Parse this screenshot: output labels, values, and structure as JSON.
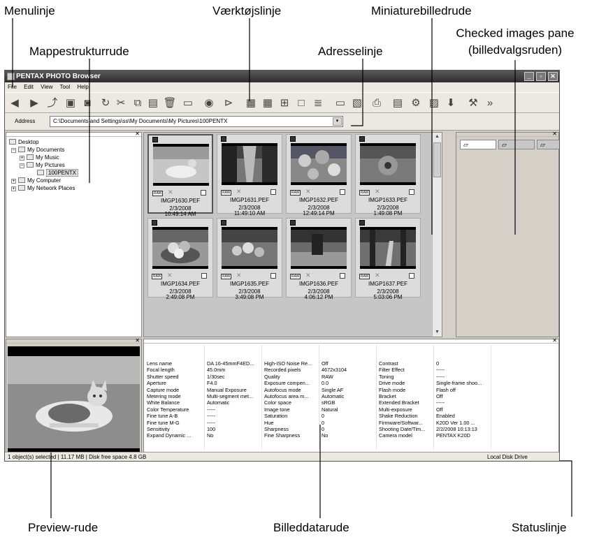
{
  "callouts": {
    "menulinje": "Menulinje",
    "vaerktojslinje": "Værktøjslinje",
    "miniaturebilledrude": "Miniaturebilledrude",
    "mappestrukturrude": "Mappestrukturrude",
    "adresselinje": "Adresselinje",
    "checked_line1": "Checked images pane",
    "checked_line2": "(billedvalgsruden)",
    "preview_rude": "Preview-rude",
    "billeddatarude": "Billeddatarude",
    "statuslinje": "Statuslinje"
  },
  "window": {
    "title": "PENTAX PHOTO Browser",
    "menu": [
      "File",
      "Edit",
      "View",
      "Tool",
      "Help"
    ],
    "address_label": "Address",
    "address_value": "C:\\Documents and Settings\\ss\\My Documents\\My Pictures\\100PENTX"
  },
  "toolbar_icons": [
    "back-icon",
    "forward-icon",
    "up-folder-icon",
    "3d-icon",
    "lab-icon",
    "rotate-icon",
    "cut-icon",
    "copy-icon",
    "paste-icon",
    "delete-icon",
    "slideshow-icon",
    "view-icon",
    "filter-icon",
    "grid-small-icon",
    "grid-large-icon",
    "grid-split-icon",
    "single-view-icon",
    "detail-view-icon",
    "panel-icon",
    "book-icon",
    "print-icon",
    "export-icon",
    "settings-icon",
    "camera-icon",
    "plugin-icon",
    "tools-icon",
    "more-icon"
  ],
  "folder_tree": {
    "desktop": "Desktop",
    "my_documents": "My Documents",
    "my_music": "My Music",
    "my_pictures": "My Pictures",
    "folder_100pentx": "100PENTX",
    "my_computer": "My Computer",
    "my_network": "My Network Places"
  },
  "thumbnails": [
    {
      "name": "IMGP1630.PEF",
      "date": "2/3/2008",
      "time": "10:49:14 AM",
      "scene": "cat",
      "selected": true
    },
    {
      "name": "IMGP1631.PEF",
      "date": "2/3/2008",
      "time": "11:49:10 AM",
      "scene": "alley",
      "selected": false
    },
    {
      "name": "IMGP1632.PEF",
      "date": "2/3/2008",
      "time": "12:49:14 PM",
      "scene": "flowers",
      "selected": false
    },
    {
      "name": "IMGP1633.PEF",
      "date": "2/3/2008",
      "time": "1:49:08 PM",
      "scene": "flower-close",
      "selected": false
    },
    {
      "name": "IMGP1634.PEF",
      "date": "2/3/2008",
      "time": "2:49:08 PM",
      "scene": "fruit-basket",
      "selected": false
    },
    {
      "name": "IMGP1635.PEF",
      "date": "2/3/2008",
      "time": "3:49:08 PM",
      "scene": "fruit-table",
      "selected": false
    },
    {
      "name": "IMGP1636.PEF",
      "date": "2/3/2008",
      "time": "4:06:12 PM",
      "scene": "garden",
      "selected": false
    },
    {
      "name": "IMGP1637.PEF",
      "date": "2/3/2008",
      "time": "5:03:06 PM",
      "scene": "forest-path",
      "selected": false
    }
  ],
  "checked_tabs": [
    "tab-1",
    "tab-2",
    "tab-3"
  ],
  "image_data": {
    "col1_labels": [
      "Lens name",
      "Focal length",
      "Shutter speed",
      "Aperture",
      "Capture mode",
      "Metering mode",
      "White Balance",
      "Color Temperature",
      "Fine tune A-B",
      "Fine tune M-G",
      "Sensitivity",
      "Expand Dynamic ..."
    ],
    "col1_values": [
      "DA 16-45mmF4ED...",
      "45.0mm",
      "1/30sec",
      "F4.0",
      "Manual Exposure",
      "Multi-segment met...",
      "Automatic",
      "-----",
      "-----",
      "-----",
      "100",
      "No"
    ],
    "col2_labels": [
      "High-ISO Noise Re...",
      "Recorded pixels",
      "Quality",
      "Exposure compen...",
      "Autofocus mode",
      "Autofocus area m...",
      "Color space",
      "Image tone",
      "Saturation",
      "Hue",
      "Sharpness",
      "Fine Sharpness"
    ],
    "col2_values": [
      "Off",
      "4672x3104",
      "RAW",
      "0.0",
      "Single AF",
      "Automatic",
      "sRGB",
      "Natural",
      "0",
      "0",
      "0",
      "No"
    ],
    "col3_labels": [
      "Contrast",
      "Filter Effect",
      "Toning",
      "Drive mode",
      "Flash mode",
      "Bracket",
      "Extended Bracket",
      "Multi-exposure",
      "Shake Reduction",
      "Firmware/Softwar...",
      "Shooting Date/Tim...",
      "Camera model"
    ],
    "col3_values": [
      "0",
      "-----",
      "-----",
      "Single-frame shoo...",
      "Flash off",
      "Off",
      "-----",
      "Off",
      "Enabled",
      "K20D Ver 1.00     ...",
      "2/2/2008 10:13:13",
      "PENTAX K20D"
    ]
  },
  "status": {
    "left": "1 object(s) selected | 11.17 MB | Disk free space 4.8 GB",
    "right": "Local Disk Drive"
  }
}
